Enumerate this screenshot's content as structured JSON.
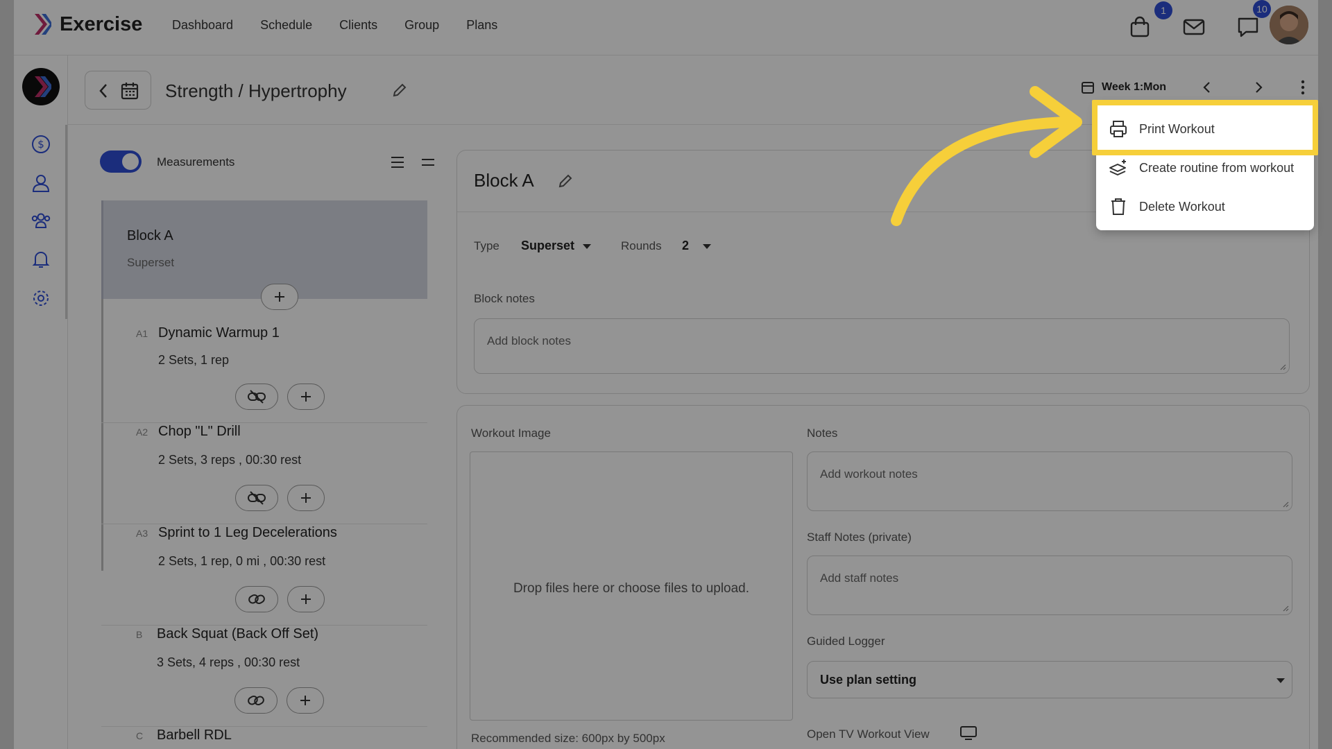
{
  "app": {
    "name": "Exercise"
  },
  "nav": {
    "items": [
      "Dashboard",
      "Schedule",
      "Clients",
      "Group",
      "Plans"
    ]
  },
  "top_icons": {
    "cart_badge": "1",
    "chat_badge": "10"
  },
  "header": {
    "title": "Strength / Hypertrophy",
    "week": "Week 1:Mon"
  },
  "left": {
    "toggle_label": "Measurements",
    "block": {
      "name": "Block A",
      "type": "Superset"
    },
    "exercises": [
      {
        "label": "A1",
        "name": "Dynamic Warmup 1",
        "detail": "2 Sets, 1 rep"
      },
      {
        "label": "A2",
        "name": "Chop \"L\" Drill",
        "detail": "2 Sets, 3 reps , 00:30 rest"
      },
      {
        "label": "A3",
        "name": "Sprint to 1 Leg Decelerations",
        "detail": "2 Sets, 1 rep, 0 mi , 00:30 rest"
      },
      {
        "label": "B",
        "name": "Back Squat (Back Off Set)",
        "detail": "3 Sets, 4 reps , 00:30 rest"
      },
      {
        "label": "C",
        "name": "Barbell RDL",
        "detail": ""
      }
    ]
  },
  "block_panel": {
    "title": "Block A",
    "type_label": "Type",
    "type_value": "Superset",
    "rounds_label": "Rounds",
    "rounds_value": "2",
    "notes_label": "Block notes",
    "notes_placeholder": "Add block notes"
  },
  "workout_panel": {
    "image_label": "Workout Image",
    "drop_text": "Drop files here or choose files to upload.",
    "recommended": "Recommended size: 600px by 500px",
    "notes_label": "Notes",
    "notes_placeholder": "Add workout notes",
    "staff_label": "Staff Notes (private)",
    "staff_placeholder": "Add staff notes",
    "logger_label": "Guided Logger",
    "logger_value": "Use plan setting",
    "tv_label": "Open TV Workout View"
  },
  "menu": {
    "items": [
      "Print Workout",
      "Create routine from workout",
      "Delete Workout"
    ]
  },
  "colors": {
    "accent": "#2f4fd6",
    "highlight": "#f6cf3a",
    "overlay": "rgba(0,0,0,0.42)"
  }
}
